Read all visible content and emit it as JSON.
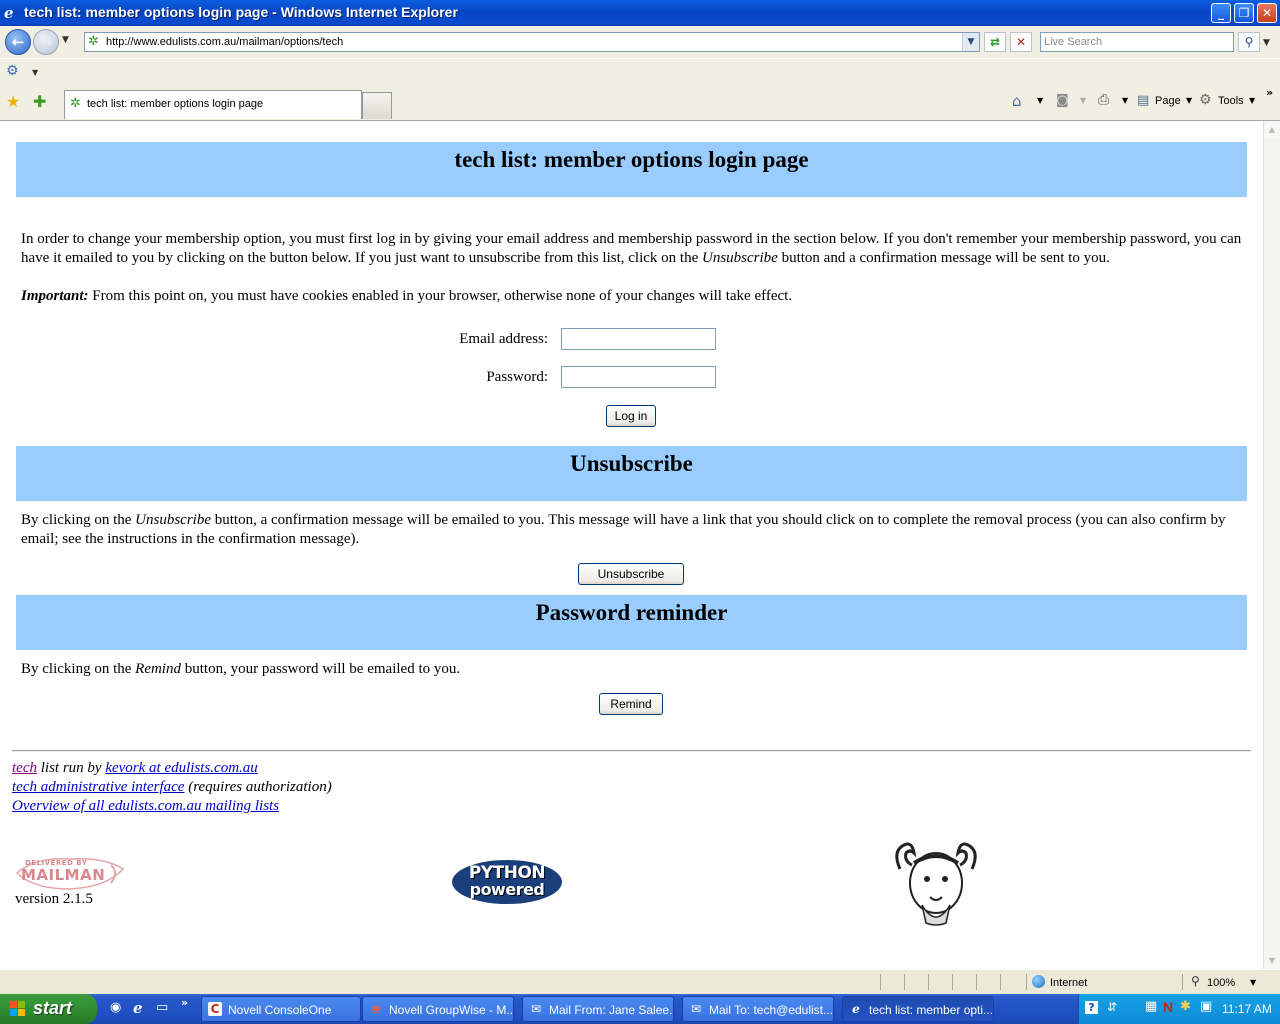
{
  "window": {
    "title": "tech list: member options login page - Windows Internet Explorer"
  },
  "browser": {
    "address": "http://www.edulists.com.au/mailman/options/tech",
    "search_placeholder": "Live Search",
    "tab_title": "tech list: member options login page",
    "commands": {
      "page": "Page",
      "tools": "Tools"
    },
    "status": {
      "zone": "Internet",
      "zoom": "100%"
    }
  },
  "page": {
    "heading": "tech list: member options login page",
    "intro_part1": "In order to change your membership option, you must first log in by giving your email address and membership password in the section below. If you don't remember your membership password, you can have it emailed to you by clicking on the button below. If you just want to unsubscribe from this list, click on the ",
    "intro_em": "Unsubscribe",
    "intro_part2": " button and a confirmation message will be sent to you.",
    "important_label": "Important:",
    "important_text": " From this point on, you must have cookies enabled in your browser, otherwise none of your changes will take effect.",
    "email_label": "Email address:",
    "password_label": "Password:",
    "login_button": "Log in",
    "unsubscribe_heading": "Unsubscribe",
    "unsub_part1": "By clicking on the ",
    "unsub_em": "Unsubscribe",
    "unsub_part2": " button, a confirmation message will be emailed to you. This message will have a link that you should click on to complete the removal process (you can also confirm by email; see the instructions in the confirmation message).",
    "unsubscribe_button": "Unsubscribe",
    "reminder_heading": "Password reminder",
    "remind_part1": "By clicking on the ",
    "remind_em": "Remind",
    "remind_part2": " button, your password will be emailed to you.",
    "remind_button": "Remind",
    "footer": {
      "list_link": "tech",
      "list_run_by": " list run by ",
      "owner_link": "kevork at edulists.com.au",
      "admin_link": "tech administrative interface",
      "admin_note": " (requires authorization)",
      "overview_link": "Overview of all edulists.com.au mailing lists"
    },
    "logos": {
      "mailman_line1": "DELIVERED BY",
      "mailman_line2": "MAILMAN",
      "version": "version 2.1.5",
      "python_line1": "PYTHON",
      "python_line2": "powered"
    }
  },
  "taskbar": {
    "start": "start",
    "tasks": [
      "Novell ConsoleOne",
      "Novell GroupWise - M...",
      "Mail From: Jane Salee...",
      "Mail To: tech@edulist...",
      "tech list: member opti..."
    ],
    "clock": "11:17 AM"
  }
}
